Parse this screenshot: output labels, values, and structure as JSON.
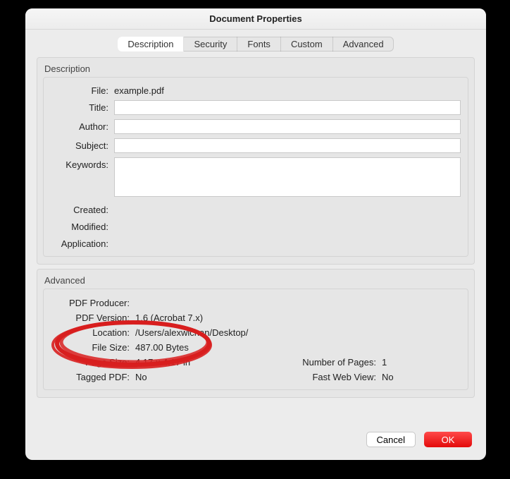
{
  "window": {
    "title": "Document Properties"
  },
  "tabs": {
    "description": "Description",
    "security": "Security",
    "fonts": "Fonts",
    "custom": "Custom",
    "advanced": "Advanced"
  },
  "groups": {
    "description_label": "Description",
    "advanced_label": "Advanced"
  },
  "desc": {
    "file_label": "File:",
    "file_value": "example.pdf",
    "title_label": "Title:",
    "title_value": "",
    "author_label": "Author:",
    "author_value": "",
    "subject_label": "Subject:",
    "subject_value": "",
    "keywords_label": "Keywords:",
    "keywords_value": "",
    "created_label": "Created:",
    "created_value": "",
    "modified_label": "Modified:",
    "modified_value": "",
    "application_label": "Application:",
    "application_value": ""
  },
  "adv": {
    "producer_label": "PDF Producer:",
    "producer_value": "",
    "version_label": "PDF Version:",
    "version_value": "1.6 (Acrobat 7.x)",
    "location_label": "Location:",
    "location_value": "/Users/alexwlchan/Desktop/",
    "filesize_label": "File Size:",
    "filesize_value": "487.00 Bytes",
    "pagesize_label": "Page Size:",
    "pagesize_value": "4.17 x 4.17 in",
    "numpages_label": "Number of Pages:",
    "numpages_value": "1",
    "tagged_label": "Tagged PDF:",
    "tagged_value": "No",
    "fastweb_label": "Fast Web View:",
    "fastweb_value": "No"
  },
  "buttons": {
    "cancel": "Cancel",
    "ok": "OK"
  },
  "annotation": {
    "color": "#d81f1f"
  }
}
